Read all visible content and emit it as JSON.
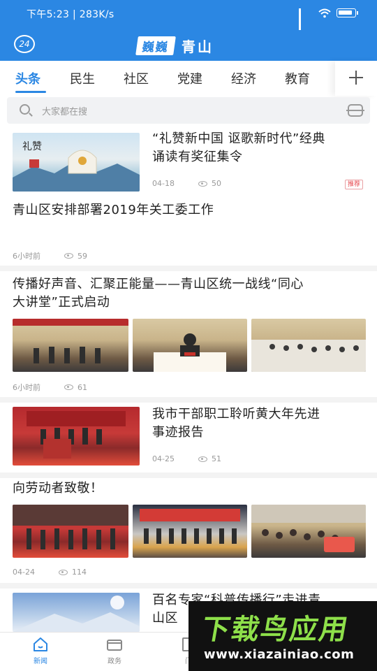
{
  "status": {
    "time_speed": "下午5:23 | 283K/s"
  },
  "header": {
    "temp": "24",
    "logo_chip": "巍巍",
    "logo_text": "青山",
    "bg_color": "#2b87e3"
  },
  "tabs": [
    {
      "label": "头条",
      "active": true
    },
    {
      "label": "民生"
    },
    {
      "label": "社区"
    },
    {
      "label": "党建"
    },
    {
      "label": "经济"
    },
    {
      "label": "教育"
    }
  ],
  "search": {
    "placeholder": "大家都在搜"
  },
  "articles": [
    {
      "title_line1": "“礼赞新中国 讴歌新时代”经典",
      "title_line2": "诵读有奖征集令",
      "date": "04-18",
      "views": "50",
      "tag": "推荐"
    },
    {
      "title": "青山区安排部署2019年关工委工作",
      "date": "6小时前",
      "views": "59"
    },
    {
      "title_line1": "传播好声音、汇聚正能量——青山区统一战线“同心",
      "title_line2": "大讲堂”正式启动",
      "date": "6小时前",
      "views": "61"
    },
    {
      "title_line1": "我市干部职工聆听黄大年先进",
      "title_line2": "事迹报告",
      "date": "04-25",
      "views": "51"
    },
    {
      "title": "向劳动者致敬！",
      "date": "04-24",
      "views": "114"
    },
    {
      "title_line1": "百名专家“科普传播行”走进青",
      "title_line2": "山区"
    }
  ],
  "bottom_nav": [
    {
      "label": "新闻",
      "icon": "home-icon",
      "active": true
    },
    {
      "label": "政务",
      "icon": "government-icon"
    },
    {
      "label": "门",
      "icon": "door-icon"
    }
  ],
  "watermark": {
    "title": "下载鸟应用",
    "url": "www.xiazainiao.com"
  }
}
